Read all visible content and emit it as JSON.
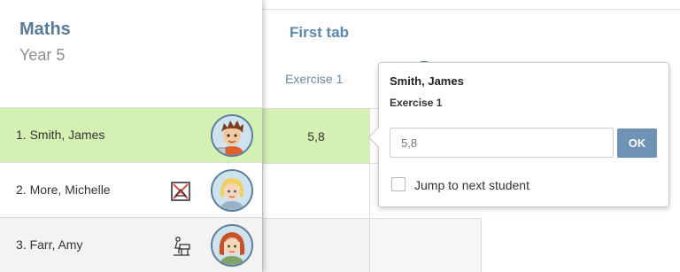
{
  "class": {
    "subject": "Maths",
    "year": "Year 5"
  },
  "tab": {
    "title": "First tab",
    "column_header": "Exercise 1"
  },
  "students": [
    {
      "name": "1. Smith, James",
      "score": "5,8",
      "status_icon": "",
      "avatar": "boy-avatar"
    },
    {
      "name": "2. More, Michelle",
      "score": "",
      "status_icon": "absent-icon",
      "avatar": "blonde-girl-avatar"
    },
    {
      "name": "3. Farr, Amy",
      "score": "",
      "status_icon": "piano-icon",
      "avatar": "redhead-girl-avatar"
    }
  ],
  "popup": {
    "student": "Smith, James",
    "exercise": "Exercise 1",
    "input_value": "5,8",
    "ok_label": "OK",
    "jump_label": "Jump to next student",
    "jump_checked": false
  },
  "colors": {
    "accent": "#5b88ad",
    "selected_row": "#d4f0b2",
    "ok_button": "#6e93b5"
  }
}
